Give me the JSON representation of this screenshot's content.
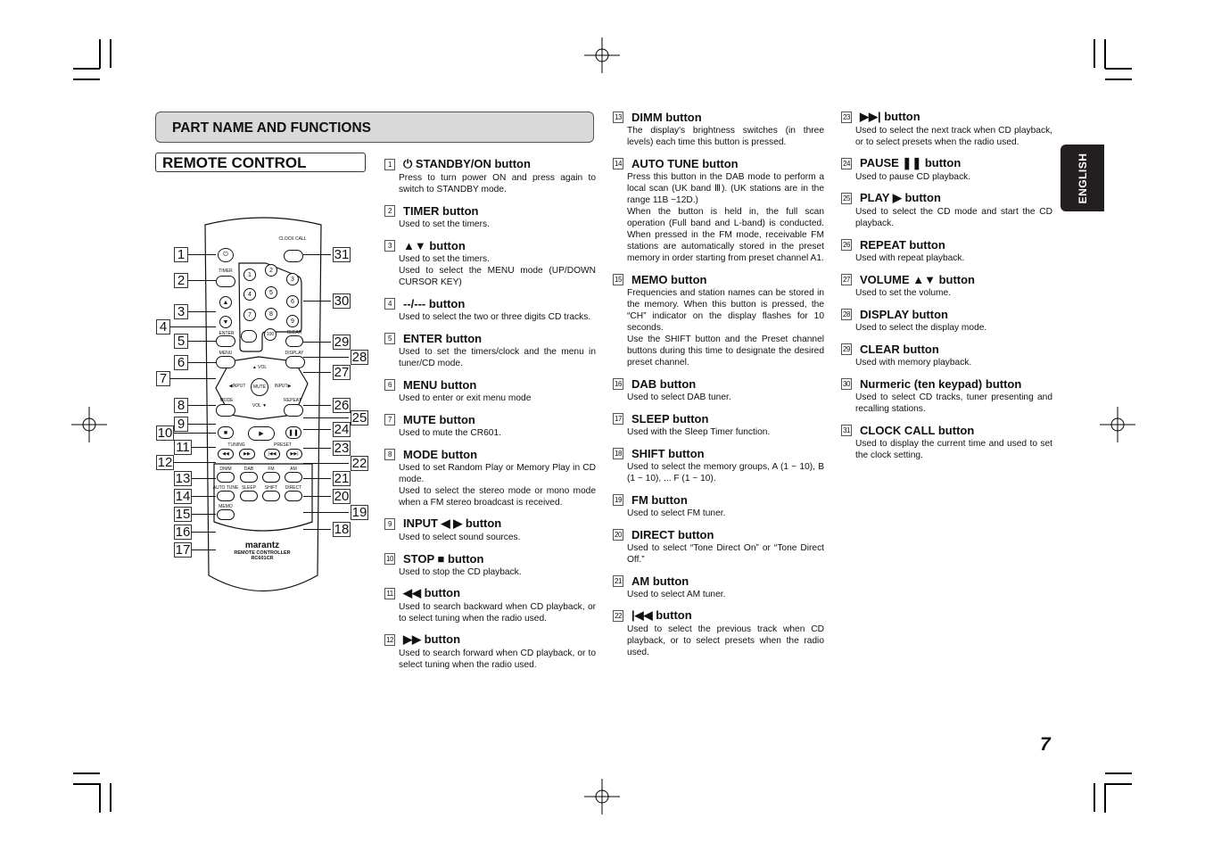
{
  "header": {
    "section_title": "PART NAME AND FUNCTIONS",
    "subsection_title": "REMOTE CONTROL",
    "language_tab": "ENGLISH",
    "page_number": "7"
  },
  "items": [
    {
      "num": "1",
      "title": "⏻ STANDBY/ON button",
      "desc": "Press to turn power ON and press again to switch to STANDBY mode."
    },
    {
      "num": "2",
      "title": "TIMER button",
      "desc": "Used to set the timers."
    },
    {
      "num": "3",
      "title": "▲▼ button",
      "desc": "Used to set the timers.\nUsed to select the MENU mode (UP/DOWN CURSOR KEY)"
    },
    {
      "num": "4",
      "title": "--/--- button",
      "desc": "Used to select the two or three digits CD tracks."
    },
    {
      "num": "5",
      "title": "ENTER button",
      "desc": "Used to set the timers/clock and the menu in tuner/CD mode."
    },
    {
      "num": "6",
      "title": "MENU button",
      "desc": "Used to enter or exit menu mode"
    },
    {
      "num": "7",
      "title": "MUTE button",
      "desc": "Used to mute the CR601."
    },
    {
      "num": "8",
      "title": "MODE button",
      "desc": "Used to set Random Play or Memory Play in CD mode.\nUsed to select the stereo mode or mono mode when a FM stereo broadcast is received."
    },
    {
      "num": "9",
      "title": "INPUT ◀ ▶ button",
      "desc": "Used to select sound sources."
    },
    {
      "num": "10",
      "title": "STOP ■ button",
      "desc": "Used to stop the CD playback."
    },
    {
      "num": "11",
      "title": "◀◀ button",
      "desc": "Used to search backward when CD playback, or to select tuning when the radio used."
    },
    {
      "num": "12",
      "title": "▶▶ button",
      "desc": "Used to search forward when CD playback, or to select tuning when the radio used."
    },
    {
      "num": "13",
      "title": "DIMM button",
      "desc": "The display's brightness switches (in three levels) each time this button is pressed."
    },
    {
      "num": "14",
      "title": "AUTO TUNE button",
      "desc": "Press this button in the DAB mode to perform a local scan (UK band Ⅲ). (UK stations are in the range 11B ~12D.)\nWhen the button is held in, the full scan operation (Full band and L-band) is conducted. When pressed in the FM mode, receivable FM stations are automatically stored in the preset memory in order starting from preset channel A1."
    },
    {
      "num": "15",
      "title": "MEMO button",
      "desc": "Frequencies and station names can be stored in the memory. When this button is pressed, the “CH” indicator on the display flashes for 10 seconds.\nUse the SHIFT button and the Preset channel buttons during this time to designate the desired preset channel."
    },
    {
      "num": "16",
      "title": "DAB button",
      "desc": "Used to select DAB tuner."
    },
    {
      "num": "17",
      "title": "SLEEP button",
      "desc": "Used with the Sleep Timer function."
    },
    {
      "num": "18",
      "title": "SHIFT button",
      "desc": "Used to select the memory groups, A (1 ~ 10), B (1 ~ 10), ... F (1 ~ 10)."
    },
    {
      "num": "19",
      "title": "FM button",
      "desc": "Used to select FM tuner."
    },
    {
      "num": "20",
      "title": "DIRECT button",
      "desc": "Used to select “Tone Direct On” or “Tone Direct Off.”"
    },
    {
      "num": "21",
      "title": "AM button",
      "desc": "Used to select AM tuner."
    },
    {
      "num": "22",
      "title": "|◀◀ button",
      "desc": "Used to select the previous track when CD playback, or to select presets when the radio used."
    },
    {
      "num": "23",
      "title": "▶▶| button",
      "desc": "Used to select the next track when CD playback, or to select presets when the radio used."
    },
    {
      "num": "24",
      "title": "PAUSE ❚❚ button",
      "desc": "Used to pause CD playback."
    },
    {
      "num": "25",
      "title": "PLAY ▶ button",
      "desc": "Used to select the CD mode and start the CD playback."
    },
    {
      "num": "26",
      "title": "REPEAT button",
      "desc": "Used with repeat playback."
    },
    {
      "num": "27",
      "title": "VOLUME ▲▼ button",
      "desc": "Used to set the volume."
    },
    {
      "num": "28",
      "title": "DISPLAY button",
      "desc": "Used to select the display mode."
    },
    {
      "num": "29",
      "title": "CLEAR button",
      "desc": "Used with memory playback."
    },
    {
      "num": "30",
      "title": "Nurmeric (ten keypad) button",
      "desc": "Used to select CD tracks, tuner presenting and recalling stations."
    },
    {
      "num": "31",
      "title": "CLOCK CALL button",
      "desc": "Used to display the current time and used to set the clock setting."
    }
  ],
  "remote": {
    "labels": {
      "clock_call": "CLOCK CALL",
      "timer": "TIMER",
      "enter": "ENTER",
      "clear": "CLEAR",
      "menu": "MENU",
      "display": "DISPLAY",
      "mode": "MODE",
      "repeat": "REPEAT",
      "input": "INPUT",
      "vol": "VOL",
      "mute": "MUTE",
      "tuning": "TUNING",
      "preset": "PRESET",
      "dimm": "DIMM",
      "dab": "DAB",
      "fm": "FM",
      "am": "AM",
      "auto_tune": "AUTO TUNE",
      "sleep": "SLEEP",
      "shift": "SHIFT",
      "direct": "DIRECT",
      "memo": "MEMO",
      "dash": "--/---",
      "hundred": "100",
      "brand": "marantz",
      "model_line1": "REMOTE CONTROLLER",
      "model_line2": "RC601CR"
    },
    "keypad": [
      "1",
      "2",
      "3",
      "4",
      "5",
      "6",
      "7",
      "8",
      "9"
    ],
    "callouts_left": [
      "1",
      "2",
      "3",
      "4",
      "5",
      "6",
      "7",
      "8",
      "9",
      "10",
      "11",
      "12",
      "13",
      "14",
      "15",
      "16",
      "17"
    ],
    "callouts_right": [
      "31",
      "30",
      "29",
      "28",
      "27",
      "26",
      "25",
      "24",
      "23",
      "22",
      "21",
      "20",
      "19",
      "18"
    ]
  }
}
